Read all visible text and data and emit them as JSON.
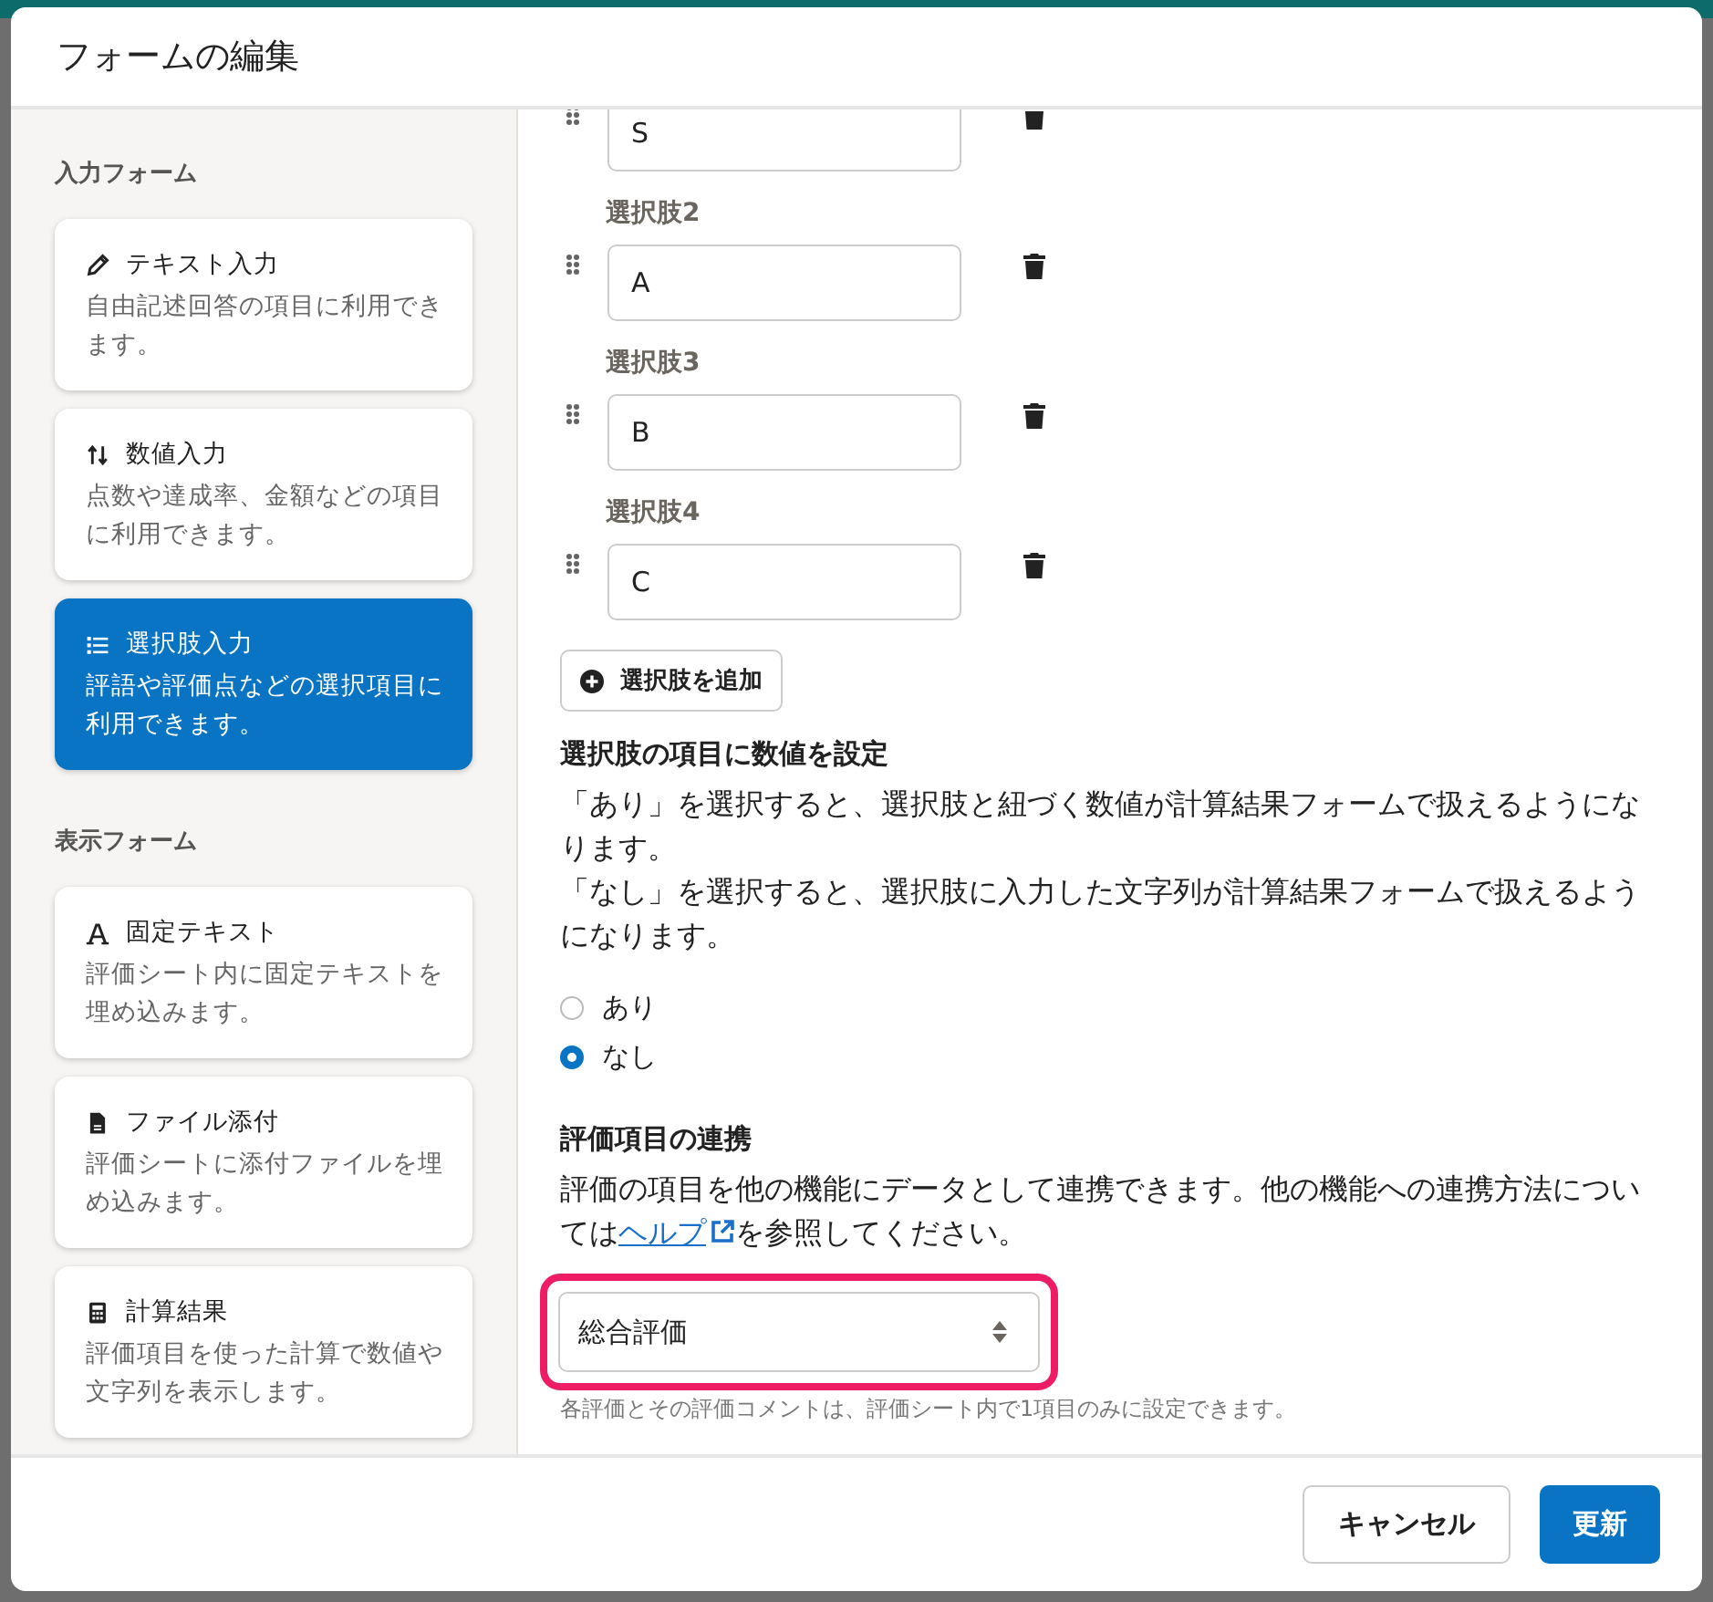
{
  "dialog": {
    "title": "フォームの編集"
  },
  "sidebar": {
    "sections": [
      {
        "heading": "入力フォーム",
        "items": [
          {
            "kind": "pencil",
            "title": "テキスト入力",
            "description": "自由記述回答の項目に利用できます。",
            "selected": false
          },
          {
            "kind": "sort",
            "title": "数値入力",
            "description": "点数や達成率、金額などの項目に利用できます。",
            "selected": false
          },
          {
            "kind": "list",
            "title": "選択肢入力",
            "description": "評語や評価点などの選択項目に利用できます。",
            "selected": true
          }
        ]
      },
      {
        "heading": "表示フォーム",
        "items": [
          {
            "kind": "letter",
            "title": "固定テキスト",
            "description": "評価シート内に固定テキストを埋め込みます。",
            "selected": false
          },
          {
            "kind": "file",
            "title": "ファイル添付",
            "description": "評価シートに添付ファイルを埋め込みます。",
            "selected": false
          },
          {
            "kind": "calculator",
            "title": "計算結果",
            "description": "評価項目を使った計算で数値や文字列を表示します。",
            "selected": false
          }
        ]
      }
    ]
  },
  "options": [
    {
      "value": "S"
    },
    {
      "label": "選択肢2",
      "value": "A"
    },
    {
      "label": "選択肢3",
      "value": "B"
    },
    {
      "label": "選択肢4",
      "value": "C"
    }
  ],
  "add_option_button": "選択肢を追加",
  "numeric_setting": {
    "heading": "選択肢の項目に数値を設定",
    "descriptions": [
      "「あり」を選択すると、選択肢と紐づく数値が計算結果フォームで扱えるようになります。",
      "「なし」を選択すると、選択肢に入力した文字列が計算結果フォームで扱えるようになります。"
    ],
    "radios": [
      {
        "label": "あり",
        "selected": false
      },
      {
        "label": "なし",
        "selected": true
      }
    ]
  },
  "linkage": {
    "heading": "評価項目の連携",
    "description_before": "評価の項目を他の機能にデータとして連携できます。他の機能への連携方法については",
    "link": "ヘルプ",
    "description_after": "を参照してください。",
    "select": {
      "value": "総合評価",
      "highlighted": true
    },
    "note": "各評価とその評価コメントは、評価シート内で1項目のみに設定できます。"
  },
  "footer": {
    "buttons": [
      {
        "label": "キャンセル",
        "kind": "secondary"
      },
      {
        "label": "更新",
        "kind": "primary"
      }
    ]
  }
}
